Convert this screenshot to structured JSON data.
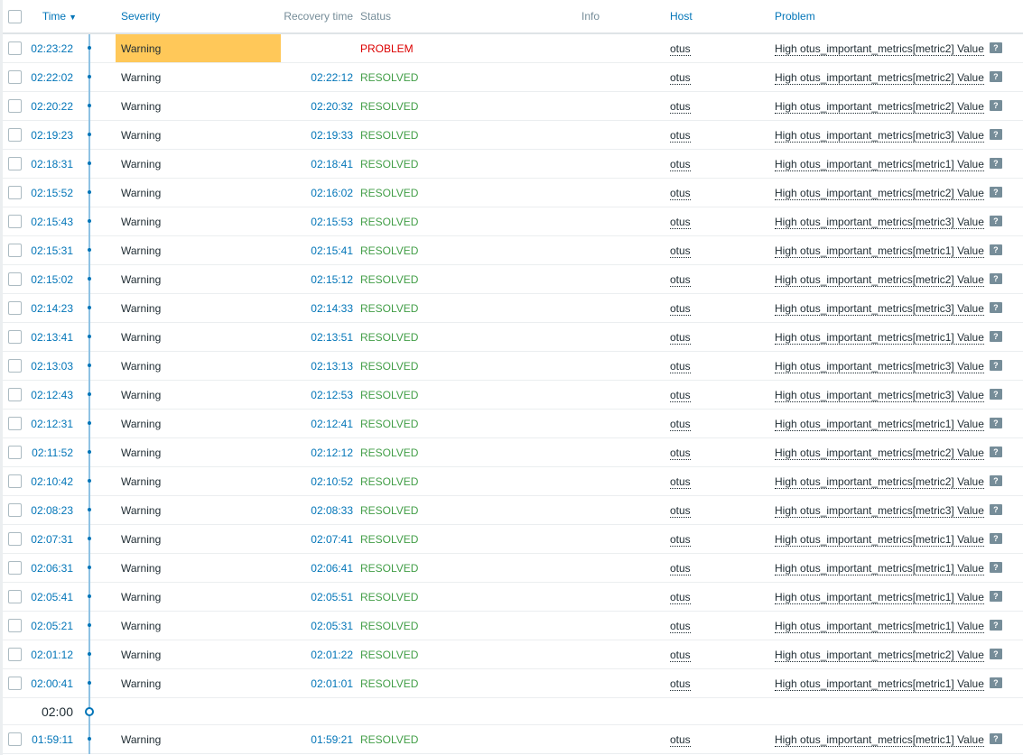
{
  "header": {
    "time": "Time",
    "severity": "Severity",
    "recovery_time": "Recovery time",
    "status": "Status",
    "info": "Info",
    "host": "Host",
    "problem": "Problem"
  },
  "colors": {
    "accent": "#0275b8",
    "warning_bg": "#ffc859",
    "problem": "#dc0000",
    "resolved": "#429e47"
  },
  "rows": [
    {
      "time": "02:23:22",
      "severity": "Warning",
      "recovery": "",
      "status": "PROBLEM",
      "host": "otus",
      "problem": "High otus_important_metrics[metric2] Value"
    },
    {
      "time": "02:22:02",
      "severity": "Warning",
      "recovery": "02:22:12",
      "status": "RESOLVED",
      "host": "otus",
      "problem": "High otus_important_metrics[metric2] Value"
    },
    {
      "time": "02:20:22",
      "severity": "Warning",
      "recovery": "02:20:32",
      "status": "RESOLVED",
      "host": "otus",
      "problem": "High otus_important_metrics[metric2] Value"
    },
    {
      "time": "02:19:23",
      "severity": "Warning",
      "recovery": "02:19:33",
      "status": "RESOLVED",
      "host": "otus",
      "problem": "High otus_important_metrics[metric3] Value"
    },
    {
      "time": "02:18:31",
      "severity": "Warning",
      "recovery": "02:18:41",
      "status": "RESOLVED",
      "host": "otus",
      "problem": "High otus_important_metrics[metric1] Value"
    },
    {
      "time": "02:15:52",
      "severity": "Warning",
      "recovery": "02:16:02",
      "status": "RESOLVED",
      "host": "otus",
      "problem": "High otus_important_metrics[metric2] Value"
    },
    {
      "time": "02:15:43",
      "severity": "Warning",
      "recovery": "02:15:53",
      "status": "RESOLVED",
      "host": "otus",
      "problem": "High otus_important_metrics[metric3] Value"
    },
    {
      "time": "02:15:31",
      "severity": "Warning",
      "recovery": "02:15:41",
      "status": "RESOLVED",
      "host": "otus",
      "problem": "High otus_important_metrics[metric1] Value"
    },
    {
      "time": "02:15:02",
      "severity": "Warning",
      "recovery": "02:15:12",
      "status": "RESOLVED",
      "host": "otus",
      "problem": "High otus_important_metrics[metric2] Value"
    },
    {
      "time": "02:14:23",
      "severity": "Warning",
      "recovery": "02:14:33",
      "status": "RESOLVED",
      "host": "otus",
      "problem": "High otus_important_metrics[metric3] Value"
    },
    {
      "time": "02:13:41",
      "severity": "Warning",
      "recovery": "02:13:51",
      "status": "RESOLVED",
      "host": "otus",
      "problem": "High otus_important_metrics[metric1] Value"
    },
    {
      "time": "02:13:03",
      "severity": "Warning",
      "recovery": "02:13:13",
      "status": "RESOLVED",
      "host": "otus",
      "problem": "High otus_important_metrics[metric3] Value"
    },
    {
      "time": "02:12:43",
      "severity": "Warning",
      "recovery": "02:12:53",
      "status": "RESOLVED",
      "host": "otus",
      "problem": "High otus_important_metrics[metric3] Value"
    },
    {
      "time": "02:12:31",
      "severity": "Warning",
      "recovery": "02:12:41",
      "status": "RESOLVED",
      "host": "otus",
      "problem": "High otus_important_metrics[metric1] Value"
    },
    {
      "time": "02:11:52",
      "severity": "Warning",
      "recovery": "02:12:12",
      "status": "RESOLVED",
      "host": "otus",
      "problem": "High otus_important_metrics[metric2] Value"
    },
    {
      "time": "02:10:42",
      "severity": "Warning",
      "recovery": "02:10:52",
      "status": "RESOLVED",
      "host": "otus",
      "problem": "High otus_important_metrics[metric2] Value"
    },
    {
      "time": "02:08:23",
      "severity": "Warning",
      "recovery": "02:08:33",
      "status": "RESOLVED",
      "host": "otus",
      "problem": "High otus_important_metrics[metric3] Value"
    },
    {
      "time": "02:07:31",
      "severity": "Warning",
      "recovery": "02:07:41",
      "status": "RESOLVED",
      "host": "otus",
      "problem": "High otus_important_metrics[metric1] Value"
    },
    {
      "time": "02:06:31",
      "severity": "Warning",
      "recovery": "02:06:41",
      "status": "RESOLVED",
      "host": "otus",
      "problem": "High otus_important_metrics[metric1] Value"
    },
    {
      "time": "02:05:41",
      "severity": "Warning",
      "recovery": "02:05:51",
      "status": "RESOLVED",
      "host": "otus",
      "problem": "High otus_important_metrics[metric1] Value"
    },
    {
      "time": "02:05:21",
      "severity": "Warning",
      "recovery": "02:05:31",
      "status": "RESOLVED",
      "host": "otus",
      "problem": "High otus_important_metrics[metric1] Value"
    },
    {
      "time": "02:01:12",
      "severity": "Warning",
      "recovery": "02:01:22",
      "status": "RESOLVED",
      "host": "otus",
      "problem": "High otus_important_metrics[metric2] Value"
    },
    {
      "time": "02:00:41",
      "severity": "Warning",
      "recovery": "02:01:01",
      "status": "RESOLVED",
      "host": "otus",
      "problem": "High otus_important_metrics[metric1] Value"
    }
  ],
  "divider": "02:00",
  "rows_after": [
    {
      "time": "01:59:11",
      "severity": "Warning",
      "recovery": "01:59:21",
      "status": "RESOLVED",
      "host": "otus",
      "problem": "High otus_important_metrics[metric1] Value"
    }
  ],
  "message_icon": "speech-bubble-icon"
}
